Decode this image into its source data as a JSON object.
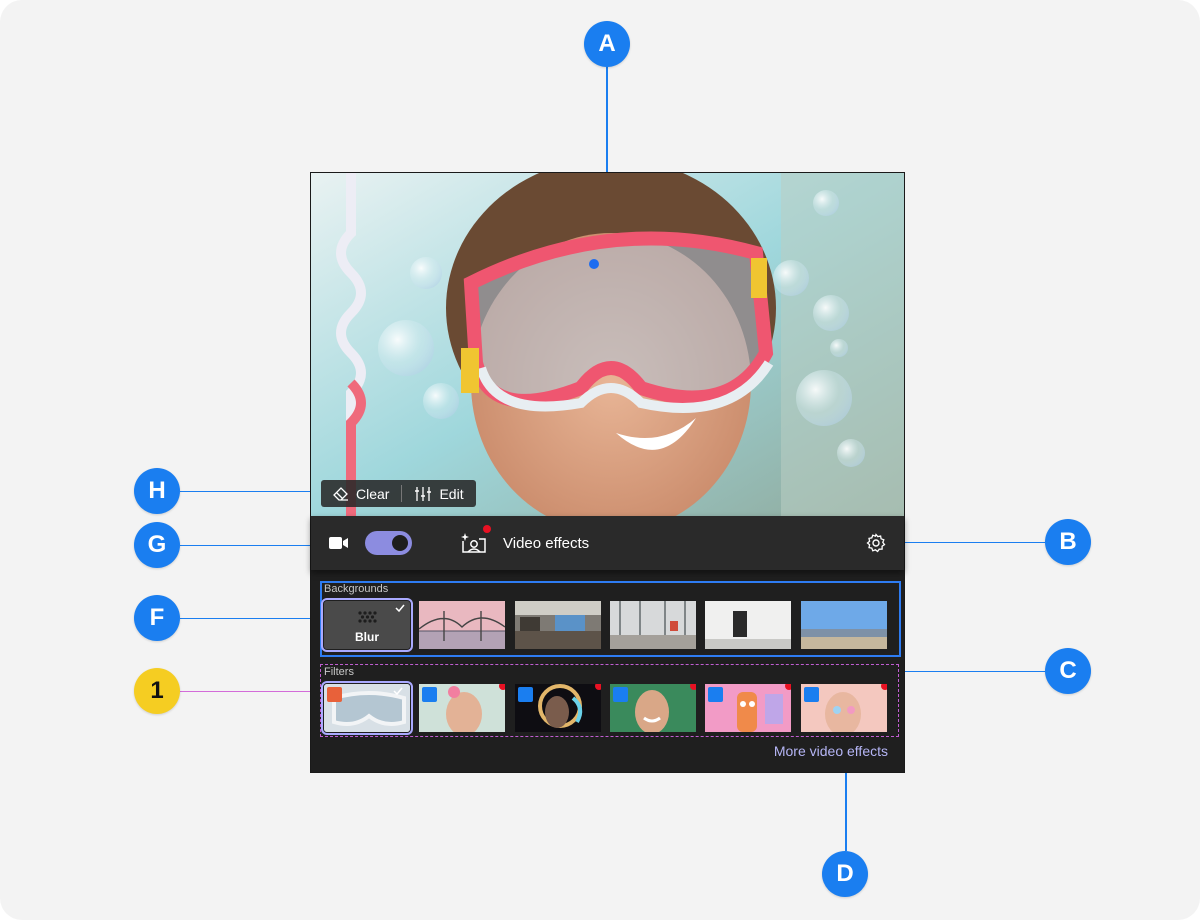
{
  "callouts": {
    "a": "A",
    "b": "B",
    "c": "C",
    "d": "D",
    "f": "F",
    "g": "G",
    "h": "H",
    "one": "1"
  },
  "preview_actions": {
    "clear_label": "Clear",
    "edit_label": "Edit"
  },
  "toolbar": {
    "video_effects_label": "Video effects"
  },
  "backgrounds": {
    "section_label": "Backgrounds",
    "blur_label": "Blur"
  },
  "filters": {
    "section_label": "Filters"
  },
  "more_link": "More video effects",
  "colors": {
    "accent_blue": "#1a7ef0",
    "highlight_yellow": "#f5cd22",
    "toggle_on": "#8c8ce0",
    "link": "#b5b5f5",
    "notification_dot": "#e81123"
  },
  "icons": [
    "eraser-icon",
    "sliders-icon",
    "camera-icon",
    "video-effects-icon",
    "gear-icon",
    "checkmark-icon"
  ]
}
